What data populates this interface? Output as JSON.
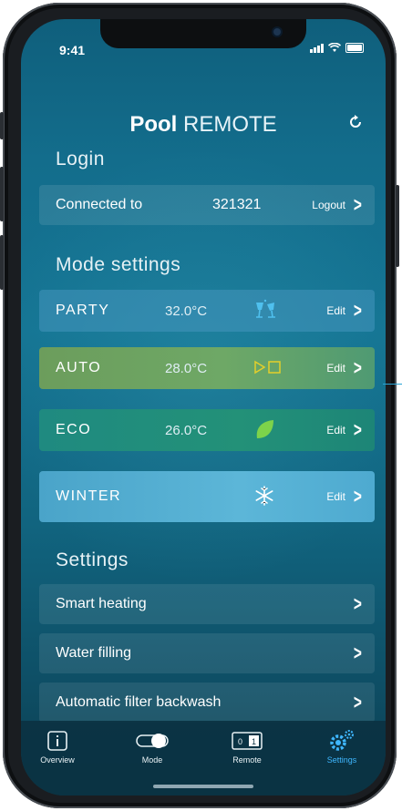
{
  "status": {
    "time": "9:41"
  },
  "header": {
    "brand_bold": "Pool",
    "brand_light": "REMOTE"
  },
  "login": {
    "section_title": "Login",
    "connected_label": "Connected to",
    "connected_value": "321321",
    "logout_label": "Logout"
  },
  "modes": {
    "section_title": "Mode settings",
    "items": [
      {
        "name": "PARTY",
        "temp": "32.0°C",
        "icon": "champagne-glasses-icon",
        "edit": "Edit"
      },
      {
        "name": "AUTO",
        "temp": "28.0°C",
        "icon": "play-stop-icon",
        "edit": "Edit"
      },
      {
        "name": "ECO",
        "temp": "26.0°C",
        "icon": "leaf-icon",
        "edit": "Edit"
      },
      {
        "name": "WINTER",
        "temp": "",
        "icon": "snowflake-icon",
        "edit": "Edit"
      }
    ]
  },
  "settings": {
    "section_title": "Settings",
    "items": [
      {
        "label": "Smart heating"
      },
      {
        "label": "Water filling"
      },
      {
        "label": "Automatic filter backwash"
      }
    ]
  },
  "tabs": [
    {
      "label": "Overview",
      "icon": "info-icon"
    },
    {
      "label": "Mode",
      "icon": "toggle-icon"
    },
    {
      "label": "Remote",
      "icon": "remote-switch-icon"
    },
    {
      "label": "Settings",
      "icon": "gear-icon",
      "active": true
    }
  ],
  "colors": {
    "accent": "#3fb7ff",
    "auto_icon": "#e3cf2b",
    "eco_icon": "#7dd34a"
  }
}
